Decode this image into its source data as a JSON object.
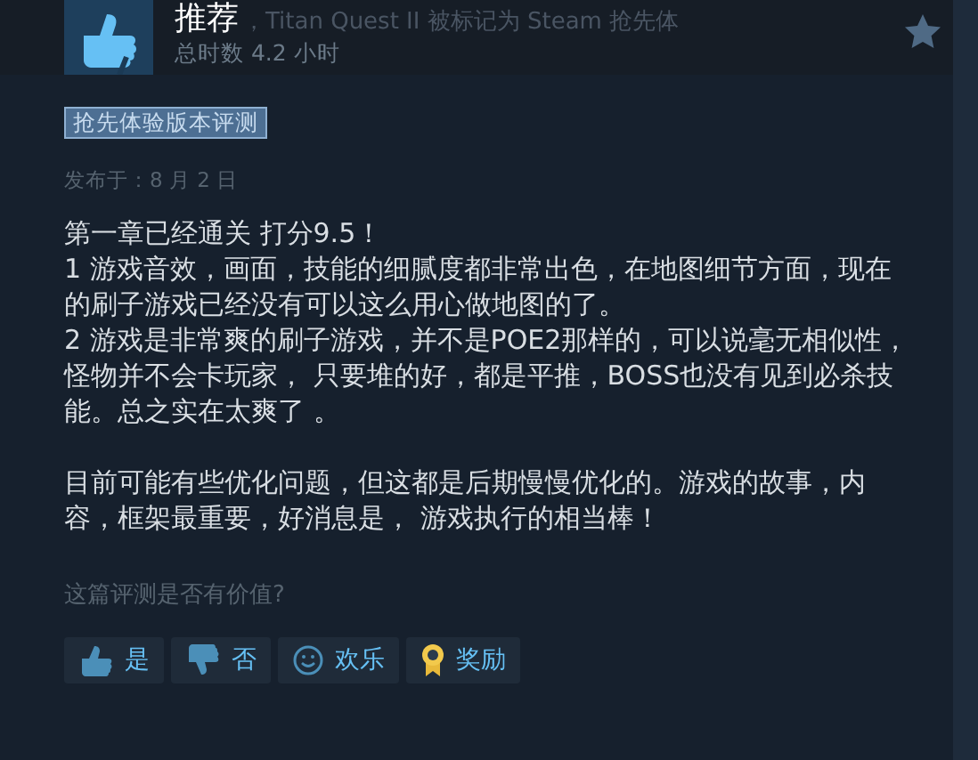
{
  "header": {
    "title": "推荐",
    "behind_text": "，Titan Quest II 被标记为 Steam 抢先体",
    "hours": "总时数 4.2 小时"
  },
  "tag": "抢先体验版本评测",
  "posted": "发布于：8 月 2 日",
  "blocks": [
    [
      "第一章已经通关 打分9.5！",
      "1 游戏音效，画面，技能的细腻度都非常出色，在地图细节方面，现在的刷子游戏已经没有可以这么用心做地图的了。",
      "2 游戏是非常爽的刷子游戏，并不是POE2那样的，可以说毫无相似性，怪物并不会卡玩家， 只要堆的好，都是平推，BOSS也没有见到必杀技能。总之实在太爽了 。"
    ],
    [
      "目前可能有些优化问题，但这都是后期慢慢优化的。游戏的故事，内容，框架最重要，好消息是， 游戏执行的相当棒！"
    ]
  ],
  "question": "这篇评测是否有价值?",
  "buttons": [
    {
      "kind": "up",
      "label": "是"
    },
    {
      "kind": "down",
      "label": "否"
    },
    {
      "kind": "funny",
      "label": "欢乐"
    },
    {
      "kind": "award",
      "label": "奖励"
    }
  ]
}
